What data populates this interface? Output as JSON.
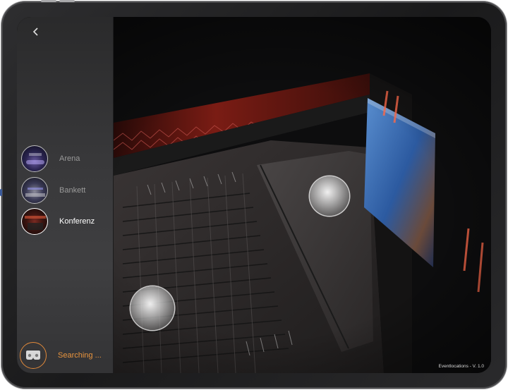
{
  "sidebar": {
    "back_icon": "chevron-left-icon",
    "items": [
      {
        "label": "Arena",
        "active": false
      },
      {
        "label": "Bankett",
        "active": false
      },
      {
        "label": "Konferenz",
        "active": true
      }
    ],
    "status": {
      "label": "Searching ...",
      "icon": "vr-headset-icon"
    }
  },
  "footer": {
    "version": "Eventlocations - V. 1.0"
  },
  "colors": {
    "accent": "#e8943e",
    "sidebar": "#3a3a3c",
    "scene_bg": "#0e0e0f",
    "wall_red": "#7a1a12"
  }
}
